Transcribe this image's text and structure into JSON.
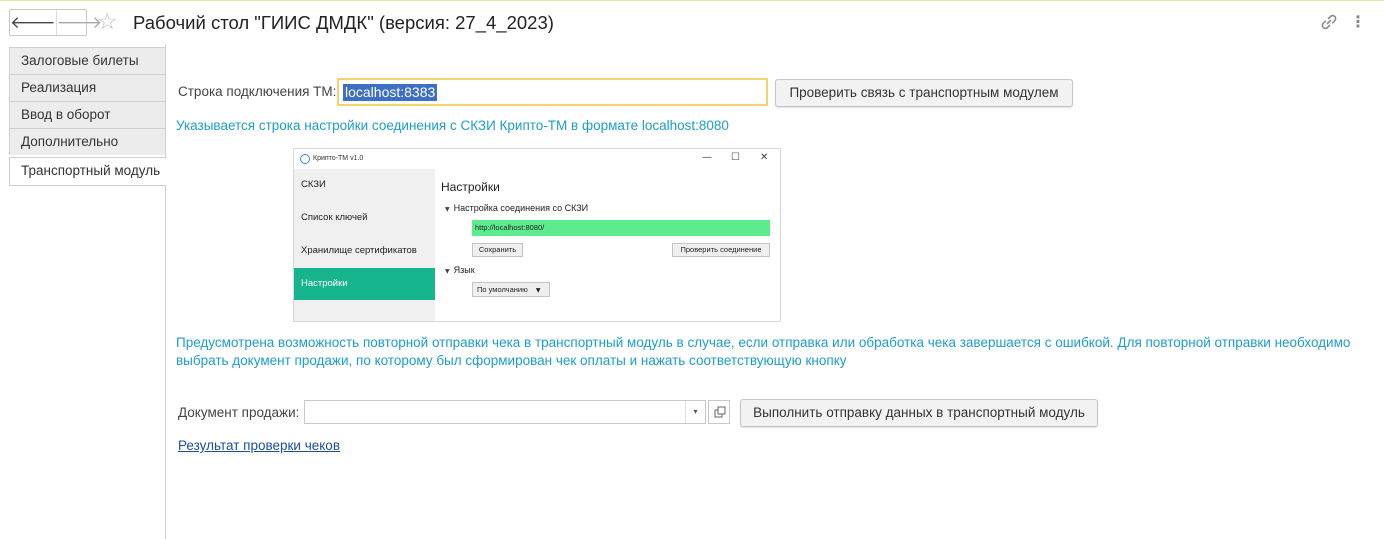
{
  "header": {
    "back_icon": "arrow-left-icon",
    "forward_icon": "arrow-right-icon",
    "back_glyph": "🡐",
    "forward_glyph": "🡒",
    "favorite_icon": "star-icon",
    "star_glyph": "☆",
    "title": "Рабочий стол \"ГИИС ДМДК\" (версия: 27_4_2023)",
    "link_icon": "link-icon",
    "more_icon": "more-vertical-icon",
    "more_glyph": "⋮"
  },
  "sidebar": {
    "items": [
      {
        "label": "Залоговые билеты",
        "active": false
      },
      {
        "label": "Реализация",
        "active": false
      },
      {
        "label": "Ввод в оборот",
        "active": false
      },
      {
        "label": "Дополнительно",
        "active": false
      },
      {
        "label": "Транспортный модуль",
        "active": true
      }
    ]
  },
  "main": {
    "connection_label": "Строка подключения ТМ:",
    "connection_value": "localhost:8383",
    "check_button": "Проверить связь с транспортным модулем",
    "connection_hint": "Указывается строка настройки соединения с СКЗИ Крипто-ТМ в формате localhost:8080",
    "resend_hint": "Предусмотрена возможность повторной  отправки чека в транспортный модуль в случае, если отправка или обработка чека завершается с ошибкой. Для повторной отправки  необходимо выбрать документ продажи, по которому был сформирован чек оплаты и нажать соответствующую кнопку",
    "document_label": "Документ продажи:",
    "document_value": "",
    "dropdown_glyph": "▾",
    "send_button": "Выполнить отправку данных в транспортный модуль",
    "results_link": "Результат проверки чеков"
  },
  "embedded_screenshot": {
    "app_title": "Крипто-ТМ v1.0",
    "minimize_glyph": "—",
    "maximize_glyph": "☐",
    "close_glyph": "✕",
    "nav_items": [
      {
        "label": "СКЗИ",
        "active": false
      },
      {
        "label": "Список ключей",
        "active": false
      },
      {
        "label": "Хранилище сертификатов",
        "active": false
      },
      {
        "label": "Настройки",
        "active": true
      }
    ],
    "heading": "Настройки",
    "section_connection": "Настройка соединения со СКЗИ",
    "url_value": "http://localhost:8080/",
    "save_button": "Сохранить",
    "check_connection_button": "Проверить соединение",
    "section_language": "Язык",
    "language_select": "По умолчанию",
    "tri_glyph": "▼"
  },
  "colors": {
    "hint_text": "#1c9dc9",
    "selection": "#3d6fc2",
    "input_focus_border": "#f5d36a",
    "embedded_active_nav": "#17b58e",
    "embedded_url_fill": "#5eeb8e",
    "link": "#1b4e9b"
  }
}
